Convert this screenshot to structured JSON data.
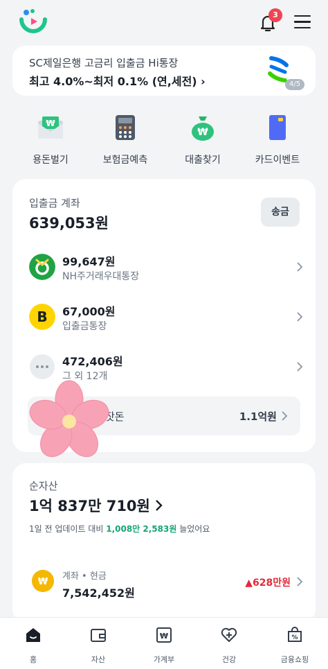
{
  "header": {
    "notification_count": "3"
  },
  "banner": {
    "line1": "SC제일은행 고금리 입출금 Hi통장",
    "line2": "최고 4.0%~최저 0.1% (연,세전) ›",
    "pager": "4/5"
  },
  "quick_menu": [
    {
      "label": "용돈벌기",
      "icon": "money-envelope-icon"
    },
    {
      "label": "보험금예측",
      "icon": "calculator-icon"
    },
    {
      "label": "대출찾기",
      "icon": "money-bag-icon"
    },
    {
      "label": "카드이벤트",
      "icon": "card-icon"
    }
  ],
  "accounts": {
    "title": "입출금 계좌",
    "total": "639,053원",
    "send_label": "송금",
    "items": [
      {
        "amount": "99,647원",
        "name": "NH주거래우대통장",
        "icon": "nh-bank-icon"
      },
      {
        "amount": "67,000원",
        "name": "입출금통장",
        "icon": "kakaobank-icon"
      },
      {
        "amount": "472,406원",
        "name": "그 외 12개",
        "icon": "more-icon"
      }
    ],
    "spare": {
      "label": "잣돈",
      "amount": "1.1억원"
    }
  },
  "net_assets": {
    "title": "순자산",
    "total": "1억 837만 710원",
    "update_prefix": "1일 전 업데이트 대비 ",
    "update_value": "1,008만 2,583원",
    "update_suffix": " 늘었어요",
    "row": {
      "name": "계좌 • 현금",
      "amount": "7,542,452원",
      "change": "▲628만원"
    }
  },
  "tabs": [
    {
      "label": "홈",
      "icon": "home-icon"
    },
    {
      "label": "자산",
      "icon": "wallet-icon"
    },
    {
      "label": "가계부",
      "icon": "ledger-icon"
    },
    {
      "label": "건강",
      "icon": "health-icon"
    },
    {
      "label": "금융쇼핑",
      "icon": "shopping-icon"
    }
  ],
  "colors": {
    "accent_green": "#16a571",
    "alert_red": "#f04452",
    "increase_red": "#e42939"
  }
}
